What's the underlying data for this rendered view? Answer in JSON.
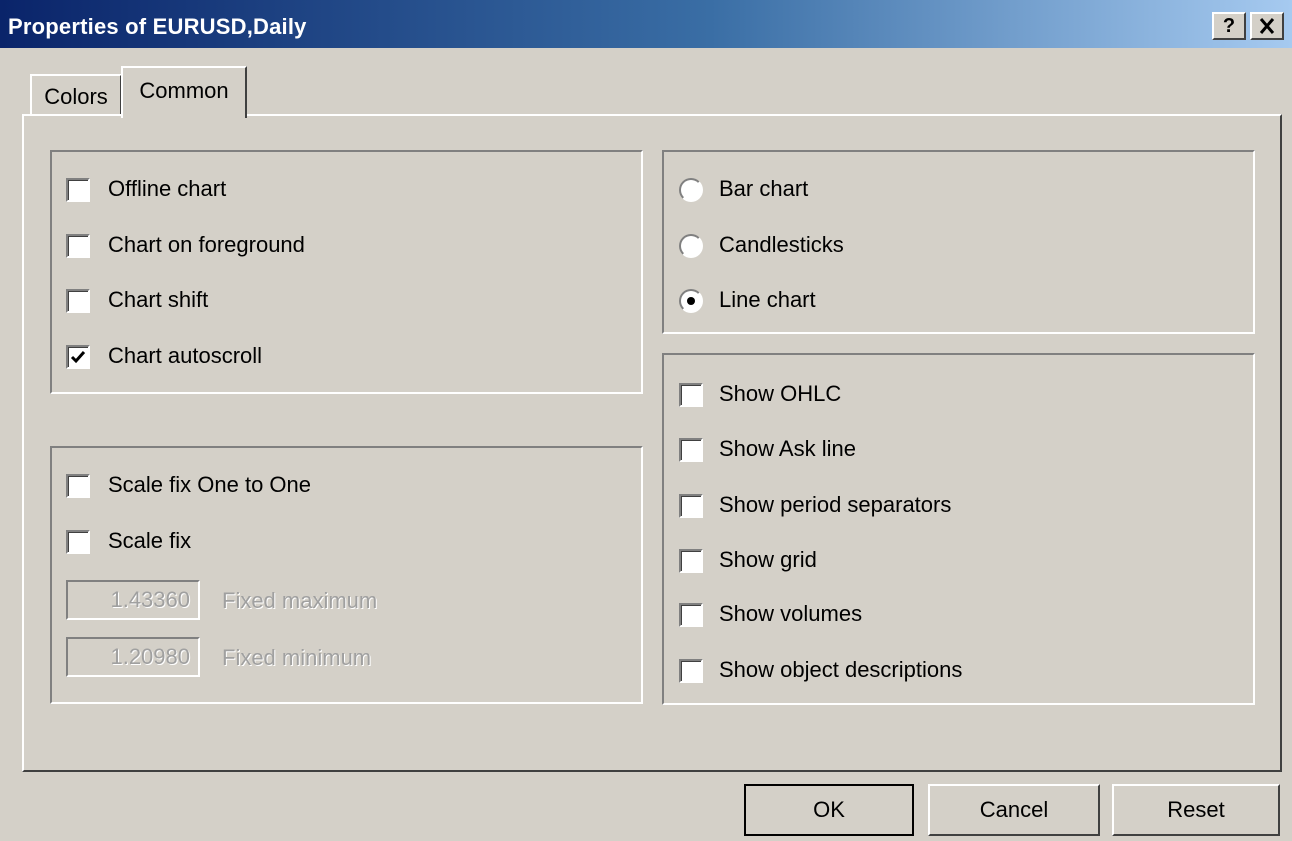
{
  "window": {
    "title": "Properties of EURUSD,Daily",
    "help_label": "?",
    "close_label": "✕"
  },
  "tabs": [
    {
      "label": "Colors",
      "active": false
    },
    {
      "label": "Common",
      "active": true
    }
  ],
  "chart_options": [
    {
      "label": "Offline chart",
      "checked": false
    },
    {
      "label": "Chart on foreground",
      "checked": false
    },
    {
      "label": "Chart shift",
      "checked": false
    },
    {
      "label": "Chart autoscroll",
      "checked": true
    }
  ],
  "scale_options": [
    {
      "label": "Scale fix One to One",
      "checked": false
    },
    {
      "label": "Scale fix",
      "checked": false
    }
  ],
  "fixed": {
    "max_value": "1.43360",
    "max_label": "Fixed maximum",
    "min_value": "1.20980",
    "min_label": "Fixed minimum"
  },
  "chart_types": [
    {
      "label": "Bar chart",
      "selected": false
    },
    {
      "label": "Candlesticks",
      "selected": false
    },
    {
      "label": "Line chart",
      "selected": true
    }
  ],
  "show_options": [
    {
      "label": "Show OHLC",
      "checked": false
    },
    {
      "label": "Show Ask line",
      "checked": false
    },
    {
      "label": "Show period separators",
      "checked": false
    },
    {
      "label": "Show grid",
      "checked": false
    },
    {
      "label": "Show volumes",
      "checked": false
    },
    {
      "label": "Show object descriptions",
      "checked": false
    }
  ],
  "buttons": {
    "ok": "OK",
    "cancel": "Cancel",
    "reset": "Reset"
  },
  "colors": {
    "face": "#d4d0c8",
    "title_start": "#0a246a",
    "title_end": "#a6caf0"
  }
}
